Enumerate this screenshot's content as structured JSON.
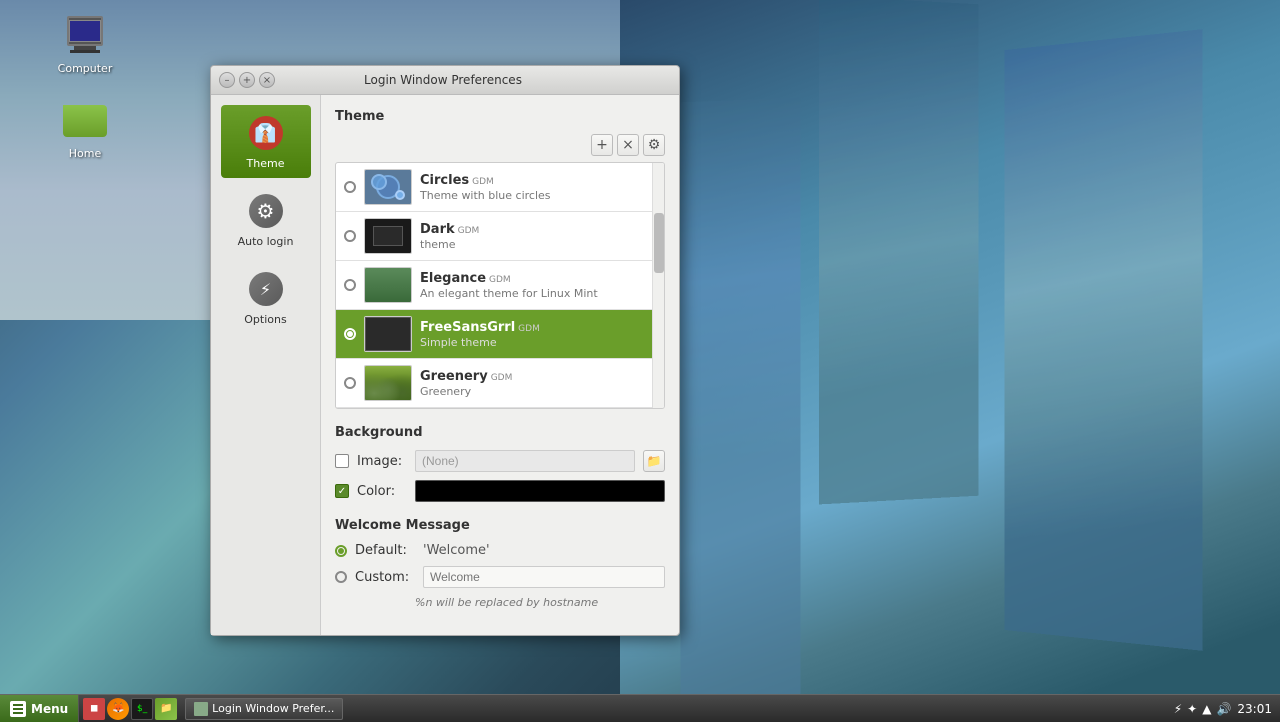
{
  "desktop": {
    "icons": [
      {
        "id": "computer",
        "label": "Computer",
        "type": "computer"
      },
      {
        "id": "home",
        "label": "Home",
        "type": "folder"
      }
    ]
  },
  "taskbar": {
    "menu_label": "Menu",
    "window_label": "Login Window Prefer...",
    "time": "23:01",
    "tray": {
      "battery": "⚡",
      "bluetooth": "✦",
      "wifi": "▲",
      "volume": "♪"
    }
  },
  "dialog": {
    "title": "Login Window Preferences",
    "sidebar": {
      "items": [
        {
          "id": "theme",
          "label": "Theme",
          "active": true
        },
        {
          "id": "autologin",
          "label": "Auto login",
          "active": false
        },
        {
          "id": "options",
          "label": "Options",
          "active": false
        }
      ]
    },
    "sections": {
      "theme": {
        "title": "Theme",
        "toolbar": {
          "add_label": "+",
          "remove_label": "×",
          "settings_label": "⚙"
        },
        "items": [
          {
            "id": "circles",
            "name": "Circles",
            "badge": "GDM",
            "desc": "Theme with blue circles",
            "selected": false,
            "thumb": "circles"
          },
          {
            "id": "dark",
            "name": "Dark",
            "badge": "GDM",
            "desc": "theme",
            "selected": false,
            "thumb": "dark"
          },
          {
            "id": "elegance",
            "name": "Elegance",
            "badge": "GDM",
            "desc": "An elegant theme for Linux Mint",
            "selected": false,
            "thumb": "elegance"
          },
          {
            "id": "freesansgrrl",
            "name": "FreeSansGrrl",
            "badge": "GDM",
            "desc": "Simple theme",
            "selected": true,
            "thumb": "freesans"
          },
          {
            "id": "greenery",
            "name": "Greenery",
            "badge": "GDM",
            "desc": "Greenery",
            "selected": false,
            "thumb": "greenery"
          }
        ]
      },
      "background": {
        "title": "Background",
        "image": {
          "checked": false,
          "label": "Image:",
          "value": "(None)",
          "placeholder": "(None)"
        },
        "color": {
          "checked": true,
          "label": "Color:",
          "value": "#000000"
        }
      },
      "welcome": {
        "title": "Welcome Message",
        "default": {
          "label": "Default:",
          "value": "'Welcome'",
          "checked": true
        },
        "custom": {
          "label": "Custom:",
          "placeholder": "Welcome",
          "checked": false
        },
        "hint": "%n will be replaced by hostname"
      }
    }
  }
}
